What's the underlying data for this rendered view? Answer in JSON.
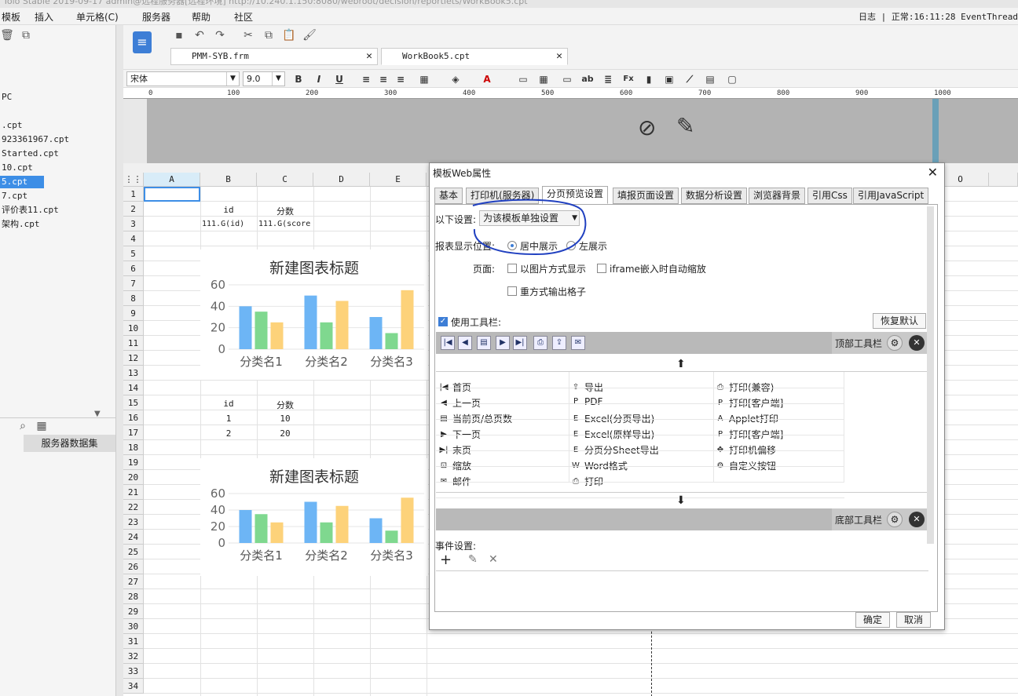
{
  "topbar": {
    "text": "Tolo Stable 2019-09-17 admin@远程服务器[远程环境] http://10.240.1.150:8080/webroot/decision/reportlets/WorkBook5.cpt"
  },
  "menu": {
    "items": [
      "模板",
      "插入",
      "单元格(C)",
      "服务器",
      "帮助",
      "社区"
    ],
    "status": "日志 | 正常:16:11:28 EventThread"
  },
  "left": {
    "files": [
      "PC",
      "",
      ".cpt",
      "923361967.cpt",
      "Started.cpt",
      "10.cpt",
      "5.cpt",
      "7.cpt",
      "评价表11.cpt",
      "架构.cpt"
    ],
    "selected_index": 6,
    "tab_server": "服务器数据集"
  },
  "tabs": [
    {
      "label": "PMM-SYB.frm"
    },
    {
      "label": "WorkBook5.cpt"
    }
  ],
  "format": {
    "font": "宋体",
    "size": "9.0",
    "bold": "B",
    "italic": "I",
    "underline": "U"
  },
  "ruler": {
    "ticks": [
      "0",
      "100",
      "200",
      "300",
      "400",
      "500",
      "600",
      "700",
      "800",
      "900",
      "1000"
    ]
  },
  "sheet": {
    "columns": [
      "A",
      "B",
      "C",
      "D",
      "E",
      "O"
    ],
    "rows": [
      "1",
      "2",
      "3",
      "4",
      "5",
      "6",
      "7",
      "8",
      "9",
      "10",
      "11",
      "12",
      "13",
      "14",
      "15",
      "16",
      "17",
      "18",
      "19",
      "20",
      "21",
      "22",
      "23",
      "24",
      "25",
      "26",
      "27",
      "28",
      "29",
      "30",
      "31",
      "32",
      "33",
      "34"
    ],
    "cells": {
      "b2": "id",
      "c2": "分数",
      "b3": "111.G(id)",
      "c3": "111.G(score",
      "b15": "id",
      "c15": "分数",
      "b16": "1",
      "c16": "10",
      "b17": "2",
      "c17": "20"
    }
  },
  "chart_data": [
    {
      "type": "bar",
      "title": "新建图表标题",
      "categories": [
        "分类名1",
        "分类名2",
        "分类名3"
      ],
      "yticks": [
        "60",
        "40",
        "20",
        "0"
      ],
      "ylim": [
        0,
        60
      ],
      "series": [
        {
          "values": [
            40,
            50,
            30
          ],
          "color": "#6db5f5"
        },
        {
          "values": [
            35,
            25,
            15
          ],
          "color": "#7fd88f"
        },
        {
          "values": [
            25,
            45,
            55
          ],
          "color": "#fdd27a"
        }
      ]
    },
    {
      "type": "bar",
      "title": "新建图表标题",
      "categories": [
        "分类名1",
        "分类名2",
        "分类名3"
      ],
      "yticks": [
        "60",
        "40",
        "20",
        "0"
      ],
      "ylim": [
        0,
        60
      ],
      "series": [
        {
          "values": [
            40,
            50,
            30
          ],
          "color": "#6db5f5"
        },
        {
          "values": [
            35,
            25,
            15
          ],
          "color": "#7fd88f"
        },
        {
          "values": [
            25,
            45,
            55
          ],
          "color": "#fdd27a"
        }
      ]
    }
  ],
  "dialog": {
    "title": "模板Web属性",
    "tabs": [
      "基本",
      "打印机(服务器)",
      "分页预览设置",
      "填报页面设置",
      "数据分析设置",
      "浏览器背景",
      "引用Css",
      "引用JavaScript"
    ],
    "active_tab": 2,
    "setting_label": "以下设置:",
    "setting_value": "为该模板单独设置",
    "position_label": "报表显示位置:",
    "position_center": "居中展示",
    "position_left": "左展示",
    "page_label": "页面:",
    "page_image": "以图片方式显示",
    "iframe_scale": "iframe嵌入时自动缩放",
    "repeat_grid": "重方式输出格子",
    "use_toolbar": "使用工具栏:",
    "restore": "恢复默认",
    "top_toolbar": "顶部工具栏",
    "bottom_toolbar": "底部工具栏",
    "event": "事件设置:",
    "ok": "确定",
    "cancel": "取消",
    "buttons_col1": [
      "首页",
      "上一页",
      "当前页/总页数",
      "下一页",
      "末页",
      "缩放",
      "邮件"
    ],
    "buttons_col2": [
      "导出",
      "PDF",
      "Excel(分页导出)",
      "Excel(原样导出)",
      "分页分Sheet导出",
      "Word格式",
      "打印"
    ],
    "buttons_col3": [
      "打印(兼容)",
      "打印[客户端]",
      "Applet打印",
      "打印[客户端]",
      "打印机偏移",
      "自定义按钮"
    ]
  }
}
